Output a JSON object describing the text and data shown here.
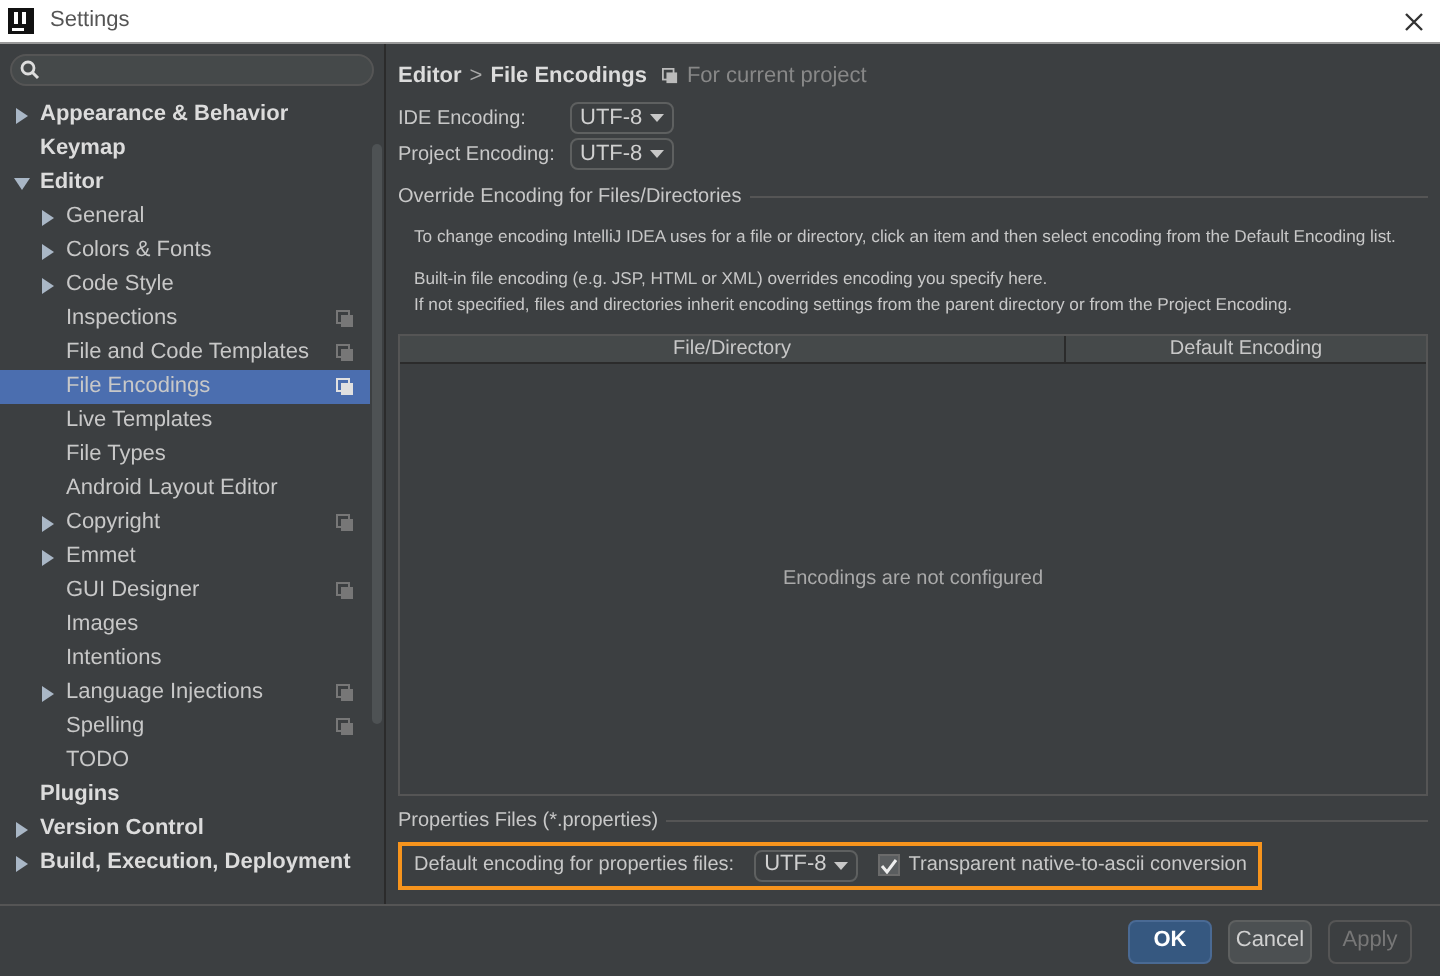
{
  "window": {
    "title": "Settings"
  },
  "sidebar": {
    "items": [
      {
        "label": "Appearance & Behavior",
        "expanded": false,
        "selected": false,
        "project_scoped": false
      },
      {
        "label": "Keymap",
        "selected": false,
        "project_scoped": false
      },
      {
        "label": "Editor",
        "expanded": true,
        "selected": false,
        "project_scoped": false,
        "children": [
          {
            "label": "General",
            "expanded": false,
            "selected": false,
            "project_scoped": false
          },
          {
            "label": "Colors & Fonts",
            "expanded": false,
            "selected": false,
            "project_scoped": false
          },
          {
            "label": "Code Style",
            "expanded": false,
            "selected": false,
            "project_scoped": false
          },
          {
            "label": "Inspections",
            "selected": false,
            "project_scoped": true
          },
          {
            "label": "File and Code Templates",
            "selected": false,
            "project_scoped": true
          },
          {
            "label": "File Encodings",
            "selected": true,
            "project_scoped": true
          },
          {
            "label": "Live Templates",
            "selected": false,
            "project_scoped": false
          },
          {
            "label": "File Types",
            "selected": false,
            "project_scoped": false
          },
          {
            "label": "Android Layout Editor",
            "selected": false,
            "project_scoped": false
          },
          {
            "label": "Copyright",
            "expanded": false,
            "selected": false,
            "project_scoped": true
          },
          {
            "label": "Emmet",
            "expanded": false,
            "selected": false,
            "project_scoped": false
          },
          {
            "label": "GUI Designer",
            "selected": false,
            "project_scoped": true
          },
          {
            "label": "Images",
            "selected": false,
            "project_scoped": false
          },
          {
            "label": "Intentions",
            "selected": false,
            "project_scoped": false
          },
          {
            "label": "Language Injections",
            "expanded": false,
            "selected": false,
            "project_scoped": true
          },
          {
            "label": "Spelling",
            "selected": false,
            "project_scoped": true
          },
          {
            "label": "TODO",
            "selected": false,
            "project_scoped": false
          }
        ]
      },
      {
        "label": "Plugins",
        "selected": false,
        "project_scoped": false
      },
      {
        "label": "Version Control",
        "expanded": false,
        "selected": false,
        "project_scoped": false
      },
      {
        "label": "Build, Execution, Deployment",
        "expanded": false,
        "selected": false,
        "project_scoped": false
      }
    ]
  },
  "breadcrumb": {
    "parent": "Editor",
    "separator": ">",
    "current": "File Encodings",
    "scope": "For current project"
  },
  "encodings": [
    {
      "label": "IDE Encoding:",
      "value": "UTF-8"
    },
    {
      "label": "Project Encoding:",
      "value": "UTF-8"
    }
  ],
  "override": {
    "title": "Override Encoding for Files/Directories",
    "paragraphs": [
      [
        "To change encoding IntelliJ IDEA uses for a file or directory, click an item and then select encoding from the Default Encoding list."
      ],
      [
        "Built-in file encoding (e.g. JSP, HTML or XML) overrides encoding you specify here.",
        "If not specified, files and directories inherit encoding settings from the parent directory or from the Project Encoding."
      ]
    ],
    "table": {
      "columns": [
        "File/Directory",
        "Default Encoding"
      ],
      "empty_text": "Encodings are not configured"
    }
  },
  "properties": {
    "title": "Properties Files (*.properties)",
    "highlighted": true,
    "label": "Default encoding for properties files:",
    "value": "UTF-8",
    "checkbox": {
      "label": "Transparent native-to-ascii conversion",
      "checked": true
    }
  },
  "buttons": [
    {
      "label": "OK",
      "kind": "primary",
      "disabled": false
    },
    {
      "label": "Cancel",
      "kind": "normal",
      "disabled": false
    },
    {
      "label": "Apply",
      "kind": "normal",
      "disabled": true
    }
  ]
}
